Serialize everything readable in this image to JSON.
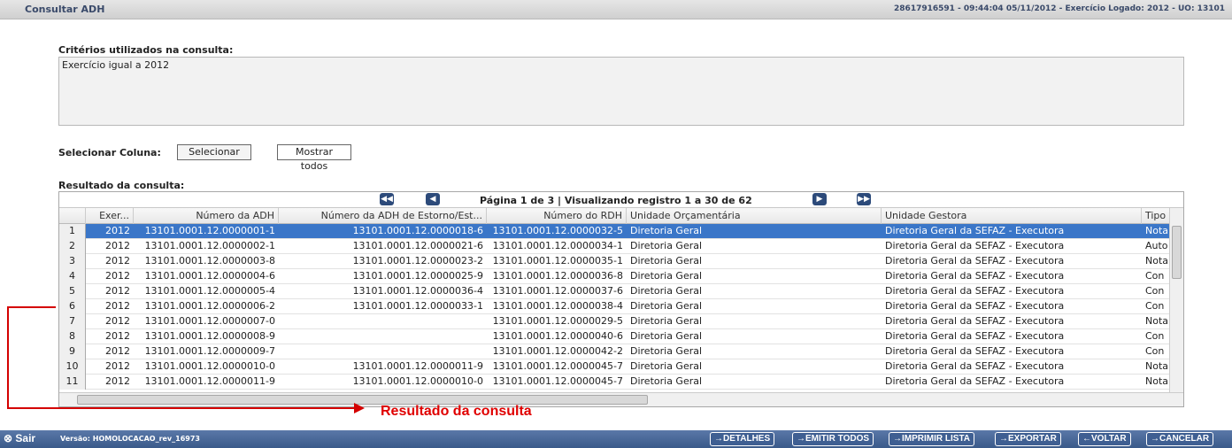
{
  "header": {
    "title": "Consultar ADH",
    "status": "28617916591 - 09:44:04 05/11/2012 - Exercício Logado: 2012 - UO: 13101"
  },
  "criteria": {
    "label": "Critérios utilizados na consulta:",
    "value": "Exercício igual a 2012"
  },
  "column_selector": {
    "label": "Selecionar Coluna:",
    "select_label": "Selecionar",
    "show_all_label": "Mostrar todos"
  },
  "results": {
    "label": "Resultado da consulta:",
    "pager_info": "Página 1 de 3 | Visualizando registro 1 a 30 de 62",
    "pager_first": "◀◀",
    "pager_prev": "◀",
    "pager_next": "▶",
    "pager_last": "▶▶",
    "columns": [
      "Exer...",
      "Número da ADH",
      "Número da ADH de Estorno/Est...",
      "Número do RDH",
      "Unidade Orçamentária",
      "Unidade Gestora",
      "Tipo"
    ],
    "rows": [
      [
        "1",
        "2012",
        "13101.0001.12.0000001-1",
        "13101.0001.12.0000018-6",
        "13101.0001.12.0000032-5",
        "Diretoria Geral",
        "Diretoria Geral da SEFAZ - Executora",
        "Nota"
      ],
      [
        "2",
        "2012",
        "13101.0001.12.0000002-1",
        "13101.0001.12.0000021-6",
        "13101.0001.12.0000034-1",
        "Diretoria Geral",
        "Diretoria Geral da SEFAZ - Executora",
        "Auto"
      ],
      [
        "3",
        "2012",
        "13101.0001.12.0000003-8",
        "13101.0001.12.0000023-2",
        "13101.0001.12.0000035-1",
        "Diretoria Geral",
        "Diretoria Geral da SEFAZ - Executora",
        "Nota"
      ],
      [
        "4",
        "2012",
        "13101.0001.12.0000004-6",
        "13101.0001.12.0000025-9",
        "13101.0001.12.0000036-8",
        "Diretoria Geral",
        "Diretoria Geral da SEFAZ - Executora",
        "Con"
      ],
      [
        "5",
        "2012",
        "13101.0001.12.0000005-4",
        "13101.0001.12.0000036-4",
        "13101.0001.12.0000037-6",
        "Diretoria Geral",
        "Diretoria Geral da SEFAZ - Executora",
        "Con"
      ],
      [
        "6",
        "2012",
        "13101.0001.12.0000006-2",
        "13101.0001.12.0000033-1",
        "13101.0001.12.0000038-4",
        "Diretoria Geral",
        "Diretoria Geral da SEFAZ - Executora",
        "Con"
      ],
      [
        "7",
        "2012",
        "13101.0001.12.0000007-0",
        "",
        "13101.0001.12.0000029-5",
        "Diretoria Geral",
        "Diretoria Geral da SEFAZ - Executora",
        "Nota"
      ],
      [
        "8",
        "2012",
        "13101.0001.12.0000008-9",
        "",
        "13101.0001.12.0000040-6",
        "Diretoria Geral",
        "Diretoria Geral da SEFAZ - Executora",
        "Con"
      ],
      [
        "9",
        "2012",
        "13101.0001.12.0000009-7",
        "",
        "13101.0001.12.0000042-2",
        "Diretoria Geral",
        "Diretoria Geral da SEFAZ - Executora",
        "Con"
      ],
      [
        "10",
        "2012",
        "13101.0001.12.0000010-0",
        "13101.0001.12.0000011-9",
        "13101.0001.12.0000045-7",
        "Diretoria Geral",
        "Diretoria Geral da SEFAZ - Executora",
        "Nota"
      ],
      [
        "11",
        "2012",
        "13101.0001.12.0000011-9",
        "13101.0001.12.0000010-0",
        "13101.0001.12.0000045-7",
        "Diretoria Geral",
        "Diretoria Geral da SEFAZ - Executora",
        "Nota"
      ]
    ],
    "selected_row": 0
  },
  "callout": {
    "text": "Resultado da consulta",
    "color": "#e00000"
  },
  "footer": {
    "sair": "Sair",
    "versao": "Versão: HOMOLOCACAO_rev_16973",
    "buttons": [
      "→DETALHES",
      "→EMITIR TODOS",
      "→IMPRIMIR LISTA",
      "→EXPORTAR",
      "←VOLTAR",
      "→CANCELAR"
    ]
  }
}
